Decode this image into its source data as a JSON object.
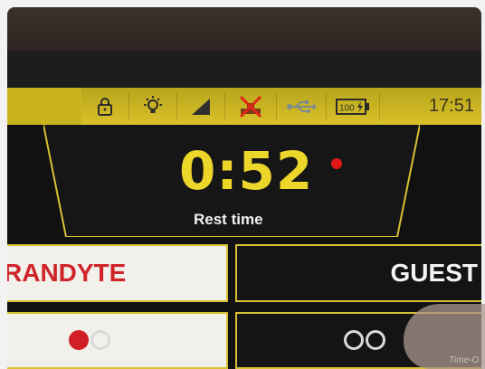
{
  "statusbar": {
    "icons": [
      "lock-icon",
      "bulb-icon",
      "signal-icon",
      "no-network-icon",
      "usb-icon",
      "battery-icon"
    ],
    "battery_level": "100",
    "clock": "17:51"
  },
  "timer": {
    "value": "0:52",
    "label": "Rest time"
  },
  "players": {
    "left_name": "RANDYTE",
    "right_name": "GUEST",
    "left_score": {
      "filled": 1,
      "empty": 1
    },
    "right_score": {
      "filled": 0,
      "empty": 2
    }
  },
  "footer": {
    "time_out_label": "Time-O"
  },
  "colors": {
    "accent_yellow": "#d8c033",
    "timer_yellow": "#ecd62a",
    "red": "#d11f26"
  }
}
